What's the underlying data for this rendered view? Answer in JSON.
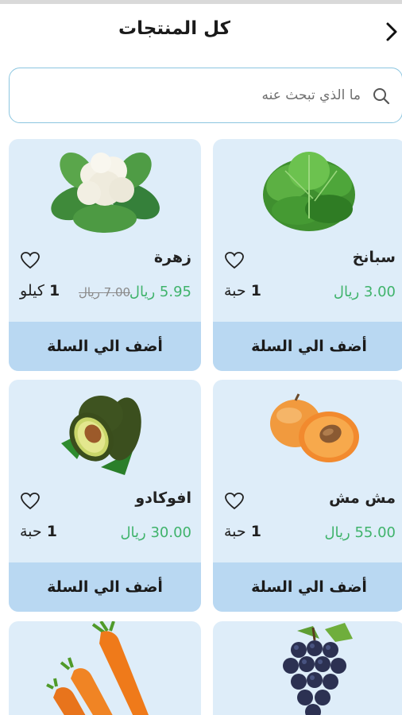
{
  "header": {
    "title": "كل المنتجات"
  },
  "search": {
    "placeholder": "ما الذي تبحث عنه"
  },
  "products": [
    {
      "name": "سبانخ",
      "price": "3.00 ريال",
      "old_price": "",
      "qty_num": "1",
      "qty_unit": "حبة",
      "add_label": "أضف الي السلة"
    },
    {
      "name": "زهرة",
      "price": "5.95 ريال",
      "old_price": "7.00 ريال",
      "qty_num": "1",
      "qty_unit": "كيلو",
      "add_label": "أضف الي السلة"
    },
    {
      "name": "مش مش",
      "price": "55.00 ريال",
      "old_price": "",
      "qty_num": "1",
      "qty_unit": "حبة",
      "add_label": "أضف الي السلة"
    },
    {
      "name": "افوكادو",
      "price": "30.00 ريال",
      "old_price": "",
      "qty_num": "1",
      "qty_unit": "حبة",
      "add_label": "أضف الي السلة"
    }
  ],
  "icons": {
    "back": "chevron-right-icon",
    "search": "search-icon",
    "favorite": "heart-outline-icon"
  },
  "colors": {
    "card_bg": "#deedf9",
    "button_bg": "#b9d8f2",
    "price_green": "#3fb36b",
    "search_border": "#8cc6e0"
  }
}
